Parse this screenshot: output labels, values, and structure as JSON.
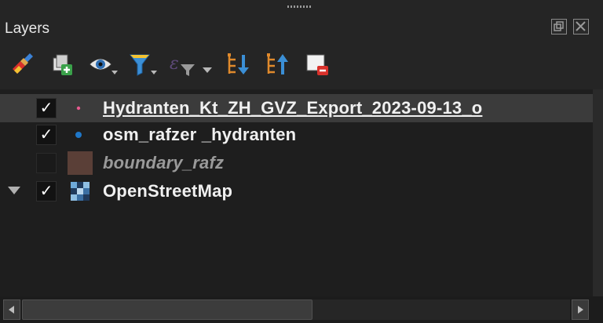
{
  "panel": {
    "title": "Layers"
  },
  "toolbar": {
    "icons": [
      "style-brush-icon",
      "add-group-icon",
      "visibility-eye-icon",
      "filter-legend-icon",
      "expression-filter-icon",
      "expand-all-icon",
      "collapse-all-icon",
      "remove-layer-icon"
    ]
  },
  "layers": [
    {
      "name": "Hydranten_Kt_ZH_GVZ_Export_2023-09-13_o",
      "checked": true,
      "selected": true,
      "icon": "pink-point-icon"
    },
    {
      "name": "osm_rafzer _hydranten",
      "checked": true,
      "selected": false,
      "icon": "blue-point-icon"
    },
    {
      "name": "boundary_rafz",
      "checked": false,
      "selected": false,
      "icon": "brown-polygon-icon"
    },
    {
      "name": "OpenStreetMap",
      "checked": true,
      "selected": false,
      "icon": "raster-tile-icon",
      "expanded": true
    }
  ],
  "check_glyph": "✓",
  "colors": {
    "background": "#1e1e1e",
    "selected_row": "#3b3b3b",
    "point_pink": "#e85a8f",
    "point_blue": "#1f77c8",
    "polygon_fill": "#5a3f37"
  }
}
